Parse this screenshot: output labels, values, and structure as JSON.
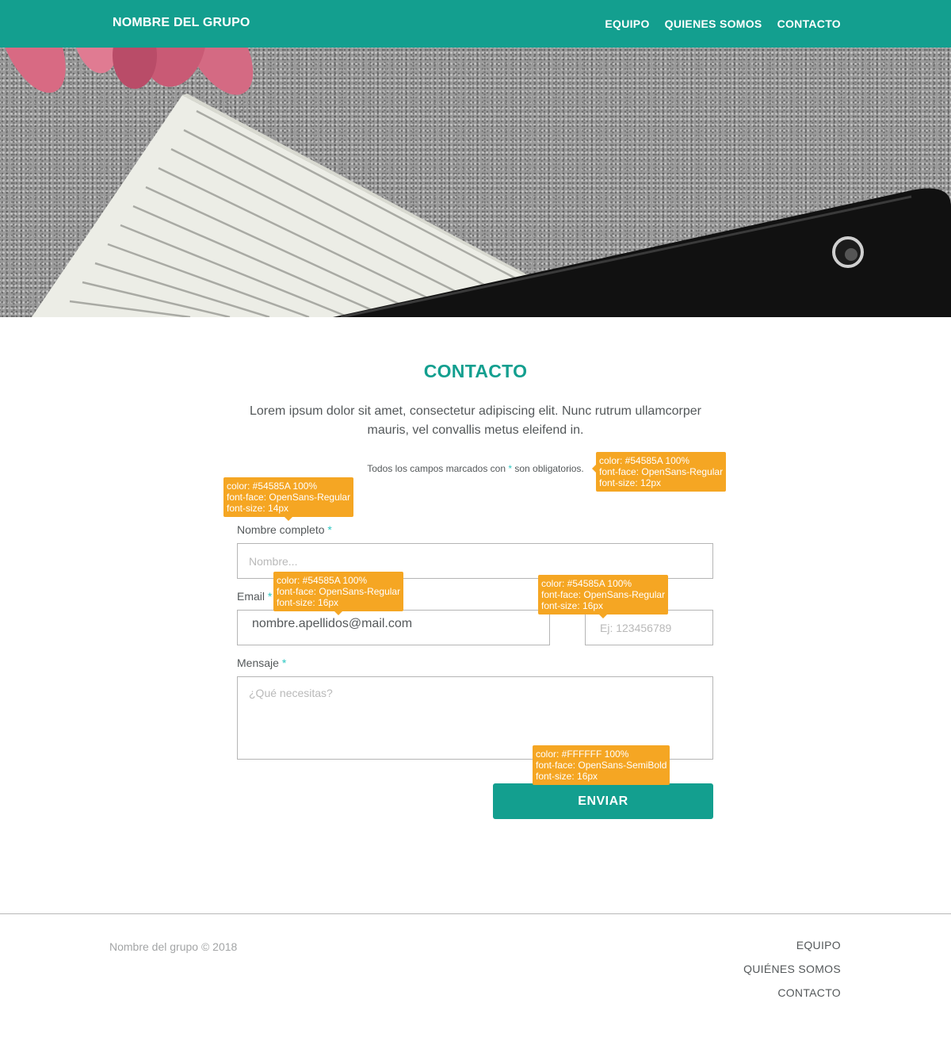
{
  "header": {
    "brand": "NOMBRE DEL GRUPO",
    "nav": [
      "EQUIPO",
      "QUIENES SOMOS",
      "CONTACTO"
    ],
    "bg_color": "#139f8f"
  },
  "hero": {
    "description": "photo"
  },
  "main": {
    "title": "CONTACTO",
    "lead": "Lorem ipsum dolor sit amet, consectetur adipiscing elit. Nunc rutrum ullamcorper mauris, vel convallis metus eleifend in.",
    "note_prefix": "Todos los campos marcados con ",
    "note_star": "*",
    "note_suffix": " son obligatorios.",
    "accent_color": "#139f8f",
    "required_color": "#2cc7c2"
  },
  "form": {
    "name_label": "Nombre completo",
    "name_placeholder": "Nombre...",
    "email_label": "Email",
    "email_value": "nombre.apellidos@mail.com",
    "phone_placeholder": "Ej: 123456789",
    "message_label": "Mensaje",
    "message_placeholder": "¿Qué necesitas?",
    "required_mark": "*",
    "submit_label": "ENVIAR"
  },
  "annotations": {
    "note": [
      "color: #54585A 100%",
      "font-face: OpenSans-Regular",
      "font-size: 12px"
    ],
    "label": [
      "color: #54585A 100%",
      "font-face: OpenSans-Regular",
      "font-size: 14px"
    ],
    "email": [
      "color: #54585A 100%",
      "font-face: OpenSans-Regular",
      "font-size: 16px"
    ],
    "phone": [
      "color: #54585A 100%",
      "font-face: OpenSans-Regular",
      "font-size: 16px"
    ],
    "button": [
      "color: #FFFFFF 100%",
      "font-face: OpenSans-SemiBold",
      "font-size: 16px"
    ],
    "color": "#f5a623"
  },
  "footer": {
    "copyright": "Nombre del grupo © 2018",
    "nav": [
      "EQUIPO",
      "QUIÉNES SOMOS",
      "CONTACTO"
    ]
  }
}
